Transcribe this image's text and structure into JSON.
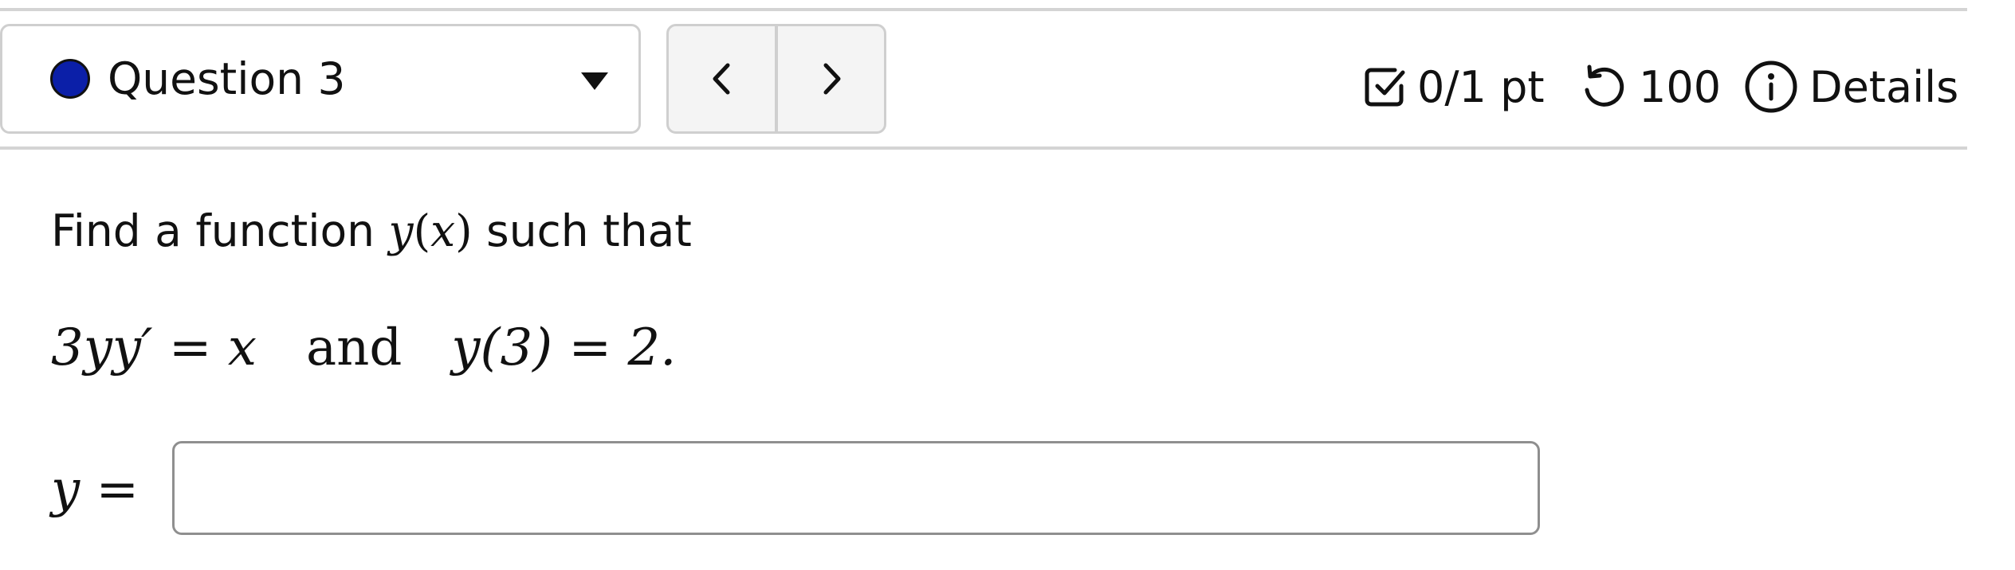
{
  "header": {
    "question_selector": {
      "label": "Question 3",
      "status_color": "#0b1fa8"
    },
    "nav": {
      "prev_icon": "chevron-left-icon",
      "next_icon": "chevron-right-icon"
    },
    "score": {
      "icon": "checkbox-icon",
      "text": "0/1 pt"
    },
    "attempts": {
      "icon": "retry-icon",
      "text": "100"
    },
    "details": {
      "icon": "info-icon",
      "text": "Details"
    }
  },
  "question": {
    "prompt_prefix": "Find a function ",
    "prompt_func": "y",
    "prompt_open": "(",
    "prompt_var": "x",
    "prompt_close": ")",
    "prompt_suffix": " such that",
    "eq_left": "3yy′ = x",
    "eq_and": "and",
    "eq_right": "y(3) = 2.",
    "answer_label": "y =",
    "answer_value": ""
  }
}
